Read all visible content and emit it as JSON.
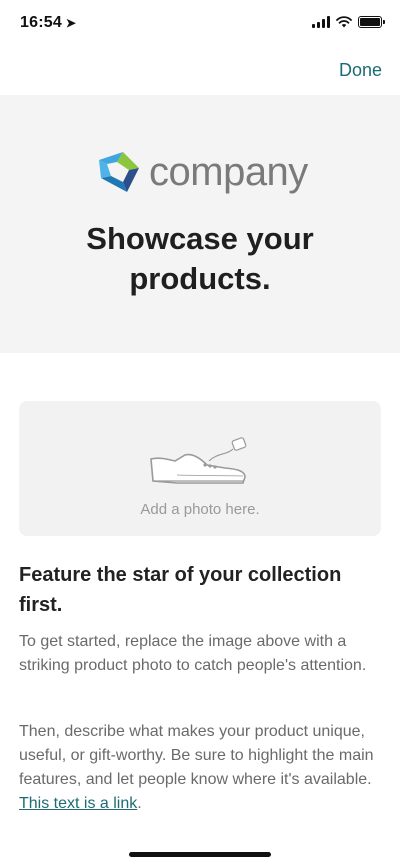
{
  "status": {
    "time": "16:54"
  },
  "header": {
    "done_label": "Done"
  },
  "hero": {
    "logo_text": "company",
    "title": "Showcase your products."
  },
  "photo": {
    "label": "Add a photo here."
  },
  "content": {
    "heading": "Feature the star of your collection first.",
    "para1": "To get started, replace the image above with a striking product photo to catch people's attention.",
    "para2_text": "Then, describe what makes your product unique, useful, or gift-worthy. Be sure to highlight the main features, and let people know where it's available.",
    "link_text": "This text is a link",
    "link_suffix": "."
  },
  "colors": {
    "accent": "#1d6b74",
    "logo_blue": "#3fa6e0",
    "logo_green": "#8cc63f",
    "logo_navy": "#2c4f8c"
  },
  "icons": [
    "location-arrow-icon",
    "signal-icon",
    "wifi-icon",
    "battery-icon",
    "shoe-icon"
  ]
}
